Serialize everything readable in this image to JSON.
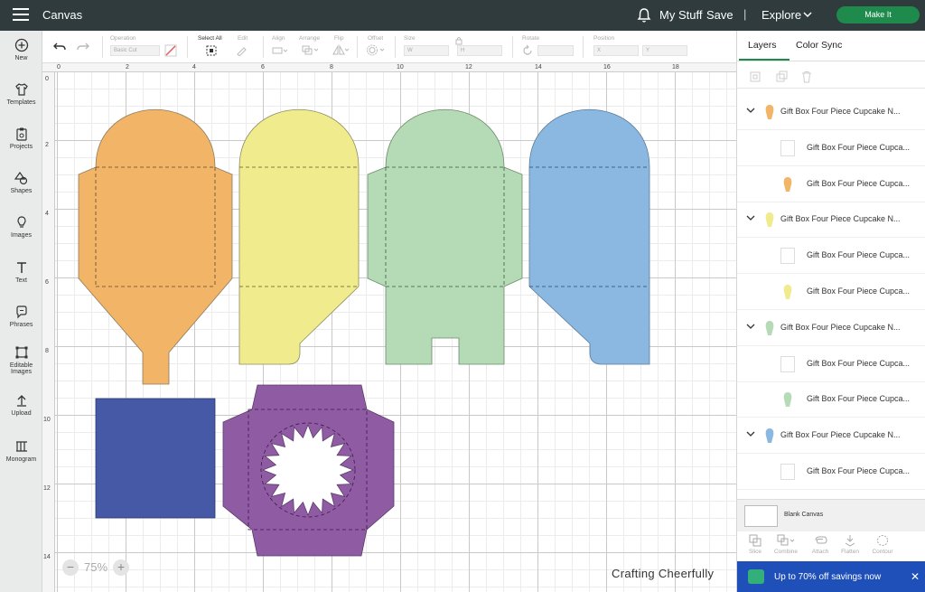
{
  "topbar": {
    "title": "Canvas",
    "my_stuff": "My Stuff",
    "save": "Save",
    "separator": "|",
    "explore": "Explore",
    "make_it": "Make It"
  },
  "left_tools": [
    "New",
    "Templates",
    "Projects",
    "Shapes",
    "Images",
    "Text",
    "Phrases",
    "Editable Images",
    "Upload",
    "Monogram"
  ],
  "toolbar": {
    "operation_label": "Operation",
    "operation_value": "Basic Cut",
    "select_all": "Select All",
    "edit": "Edit",
    "align": "Align",
    "arrange": "Arrange",
    "flip": "Flip",
    "offset": "Offset",
    "size": "Size",
    "size_w": "W",
    "size_h": "H",
    "rotate": "Rotate",
    "position": "Position",
    "pos_x": "X",
    "pos_y": "Y"
  },
  "ruler": {
    "top": [
      "0",
      "2",
      "4",
      "6",
      "8",
      "10",
      "12",
      "14",
      "16",
      "18"
    ],
    "left": [
      "0",
      "2",
      "4",
      "6",
      "8",
      "10",
      "12",
      "14"
    ]
  },
  "canvas": {
    "zoom": "75%",
    "zoom_minus": "−",
    "zoom_plus": "+",
    "watermark": "Crafting Cheerfully"
  },
  "colors": {
    "orange": "#f2b466",
    "yellow": "#f0ec8e",
    "green": "#b5dbb6",
    "blue": "#8bb8e0",
    "navy": "#4659a7",
    "purple": "#8f5ca3",
    "accent_green": "#1e8a4c",
    "promo_blue": "#1f4fb8"
  },
  "right_panel": {
    "tab_layers": "Layers",
    "tab_color_sync": "Color Sync",
    "layers": [
      {
        "name": "Gift Box Four Piece Cupcake N...",
        "kind": "group",
        "color": "#f2b466"
      },
      {
        "name": "Gift Box Four Piece Cupca...",
        "kind": "child-blank"
      },
      {
        "name": "Gift Box Four Piece Cupca...",
        "kind": "child",
        "color": "#f2b466"
      },
      {
        "name": "Gift Box Four Piece Cupcake N...",
        "kind": "group",
        "color": "#f0ec8e"
      },
      {
        "name": "Gift Box Four Piece Cupca...",
        "kind": "child-blank"
      },
      {
        "name": "Gift Box Four Piece Cupca...",
        "kind": "child",
        "color": "#f0ec8e"
      },
      {
        "name": "Gift Box Four Piece Cupcake N...",
        "kind": "group",
        "color": "#b5dbb6"
      },
      {
        "name": "Gift Box Four Piece Cupca...",
        "kind": "child-blank"
      },
      {
        "name": "Gift Box Four Piece Cupca...",
        "kind": "child",
        "color": "#b5dbb6"
      },
      {
        "name": "Gift Box Four Piece Cupcake N...",
        "kind": "group",
        "color": "#8bb8e0"
      },
      {
        "name": "Gift Box Four Piece Cupca...",
        "kind": "child-blank"
      }
    ],
    "blank_canvas": "Blank Canvas",
    "bottom_tools": [
      "Slice",
      "Combine",
      "Attach",
      "Flatten",
      "Contour"
    ],
    "promo": "Up to 70% off savings now",
    "promo_close": "✕"
  }
}
